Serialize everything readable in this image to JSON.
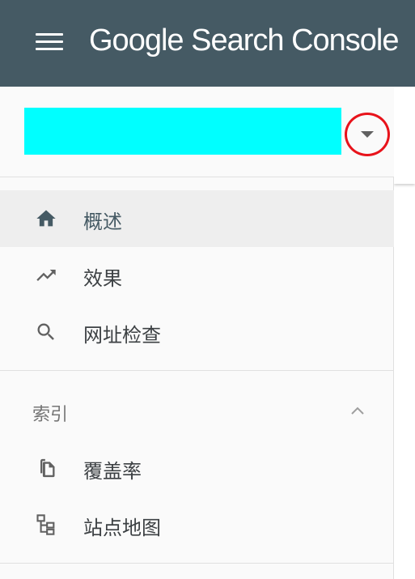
{
  "header": {
    "title_brand": "Google",
    "title_product": " Search Console",
    "background": "#455a64"
  },
  "property": {
    "name": "",
    "redaction_color": "#00ffff",
    "dropdown_icon": "caret-down-icon",
    "highlight_color": "#e8131b"
  },
  "nav": {
    "items": [
      {
        "label": "概述",
        "icon": "home-icon",
        "active": true
      },
      {
        "label": "效果",
        "icon": "trending-up-icon",
        "active": false
      },
      {
        "label": "网址检查",
        "icon": "search-icon",
        "active": false
      }
    ]
  },
  "index_section": {
    "title": "索引",
    "icon": "chevron-up-icon",
    "items": [
      {
        "label": "覆盖率",
        "icon": "copy-pages-icon"
      },
      {
        "label": "站点地图",
        "icon": "sitemap-icon"
      }
    ]
  }
}
